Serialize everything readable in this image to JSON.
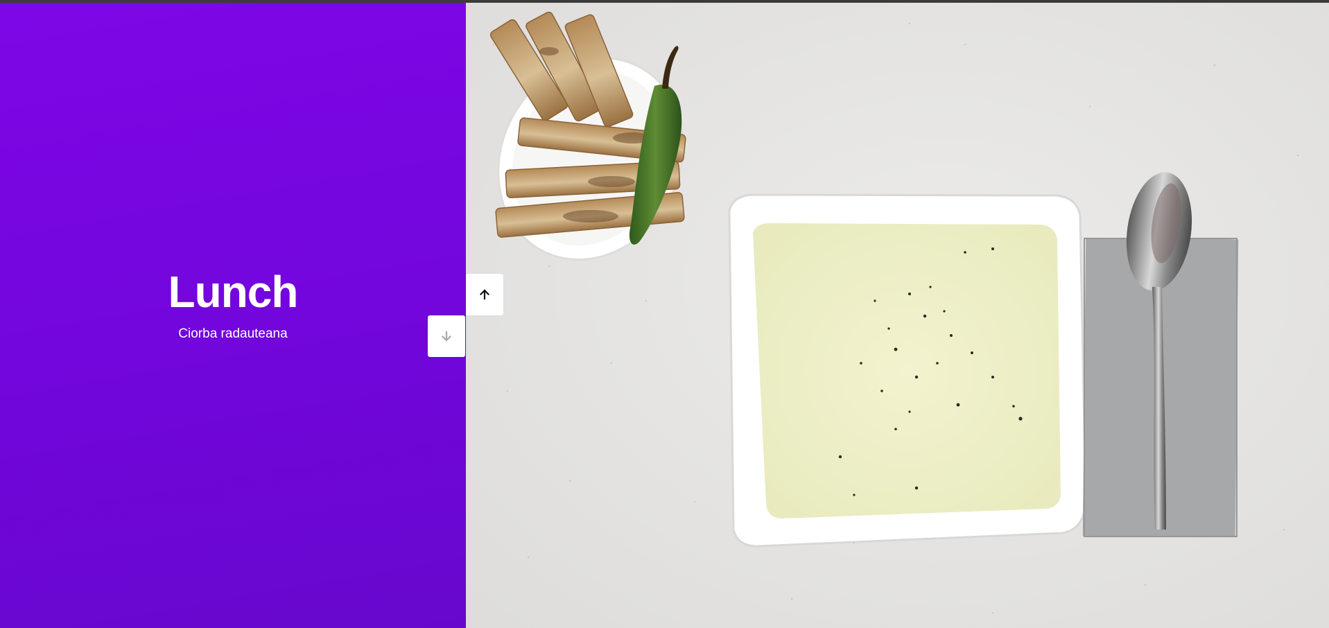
{
  "slide": {
    "title": "Lunch",
    "subtitle": "Ciorba radauteana"
  },
  "navigation": {
    "up_icon": "arrow-up-icon",
    "down_icon": "arrow-down-icon",
    "up_state": "enabled",
    "down_state": "disabled"
  },
  "photo": {
    "subject": "soup-bowl-with-bread-and-pepper"
  },
  "colors": {
    "panel_gradient_start": "#7e07e6",
    "panel_gradient_end": "#6707cd",
    "panel_text": "#ffffff",
    "button_bg": "#ffffff",
    "arrow_active": "#111111",
    "arrow_disabled": "#a9a9a9"
  }
}
